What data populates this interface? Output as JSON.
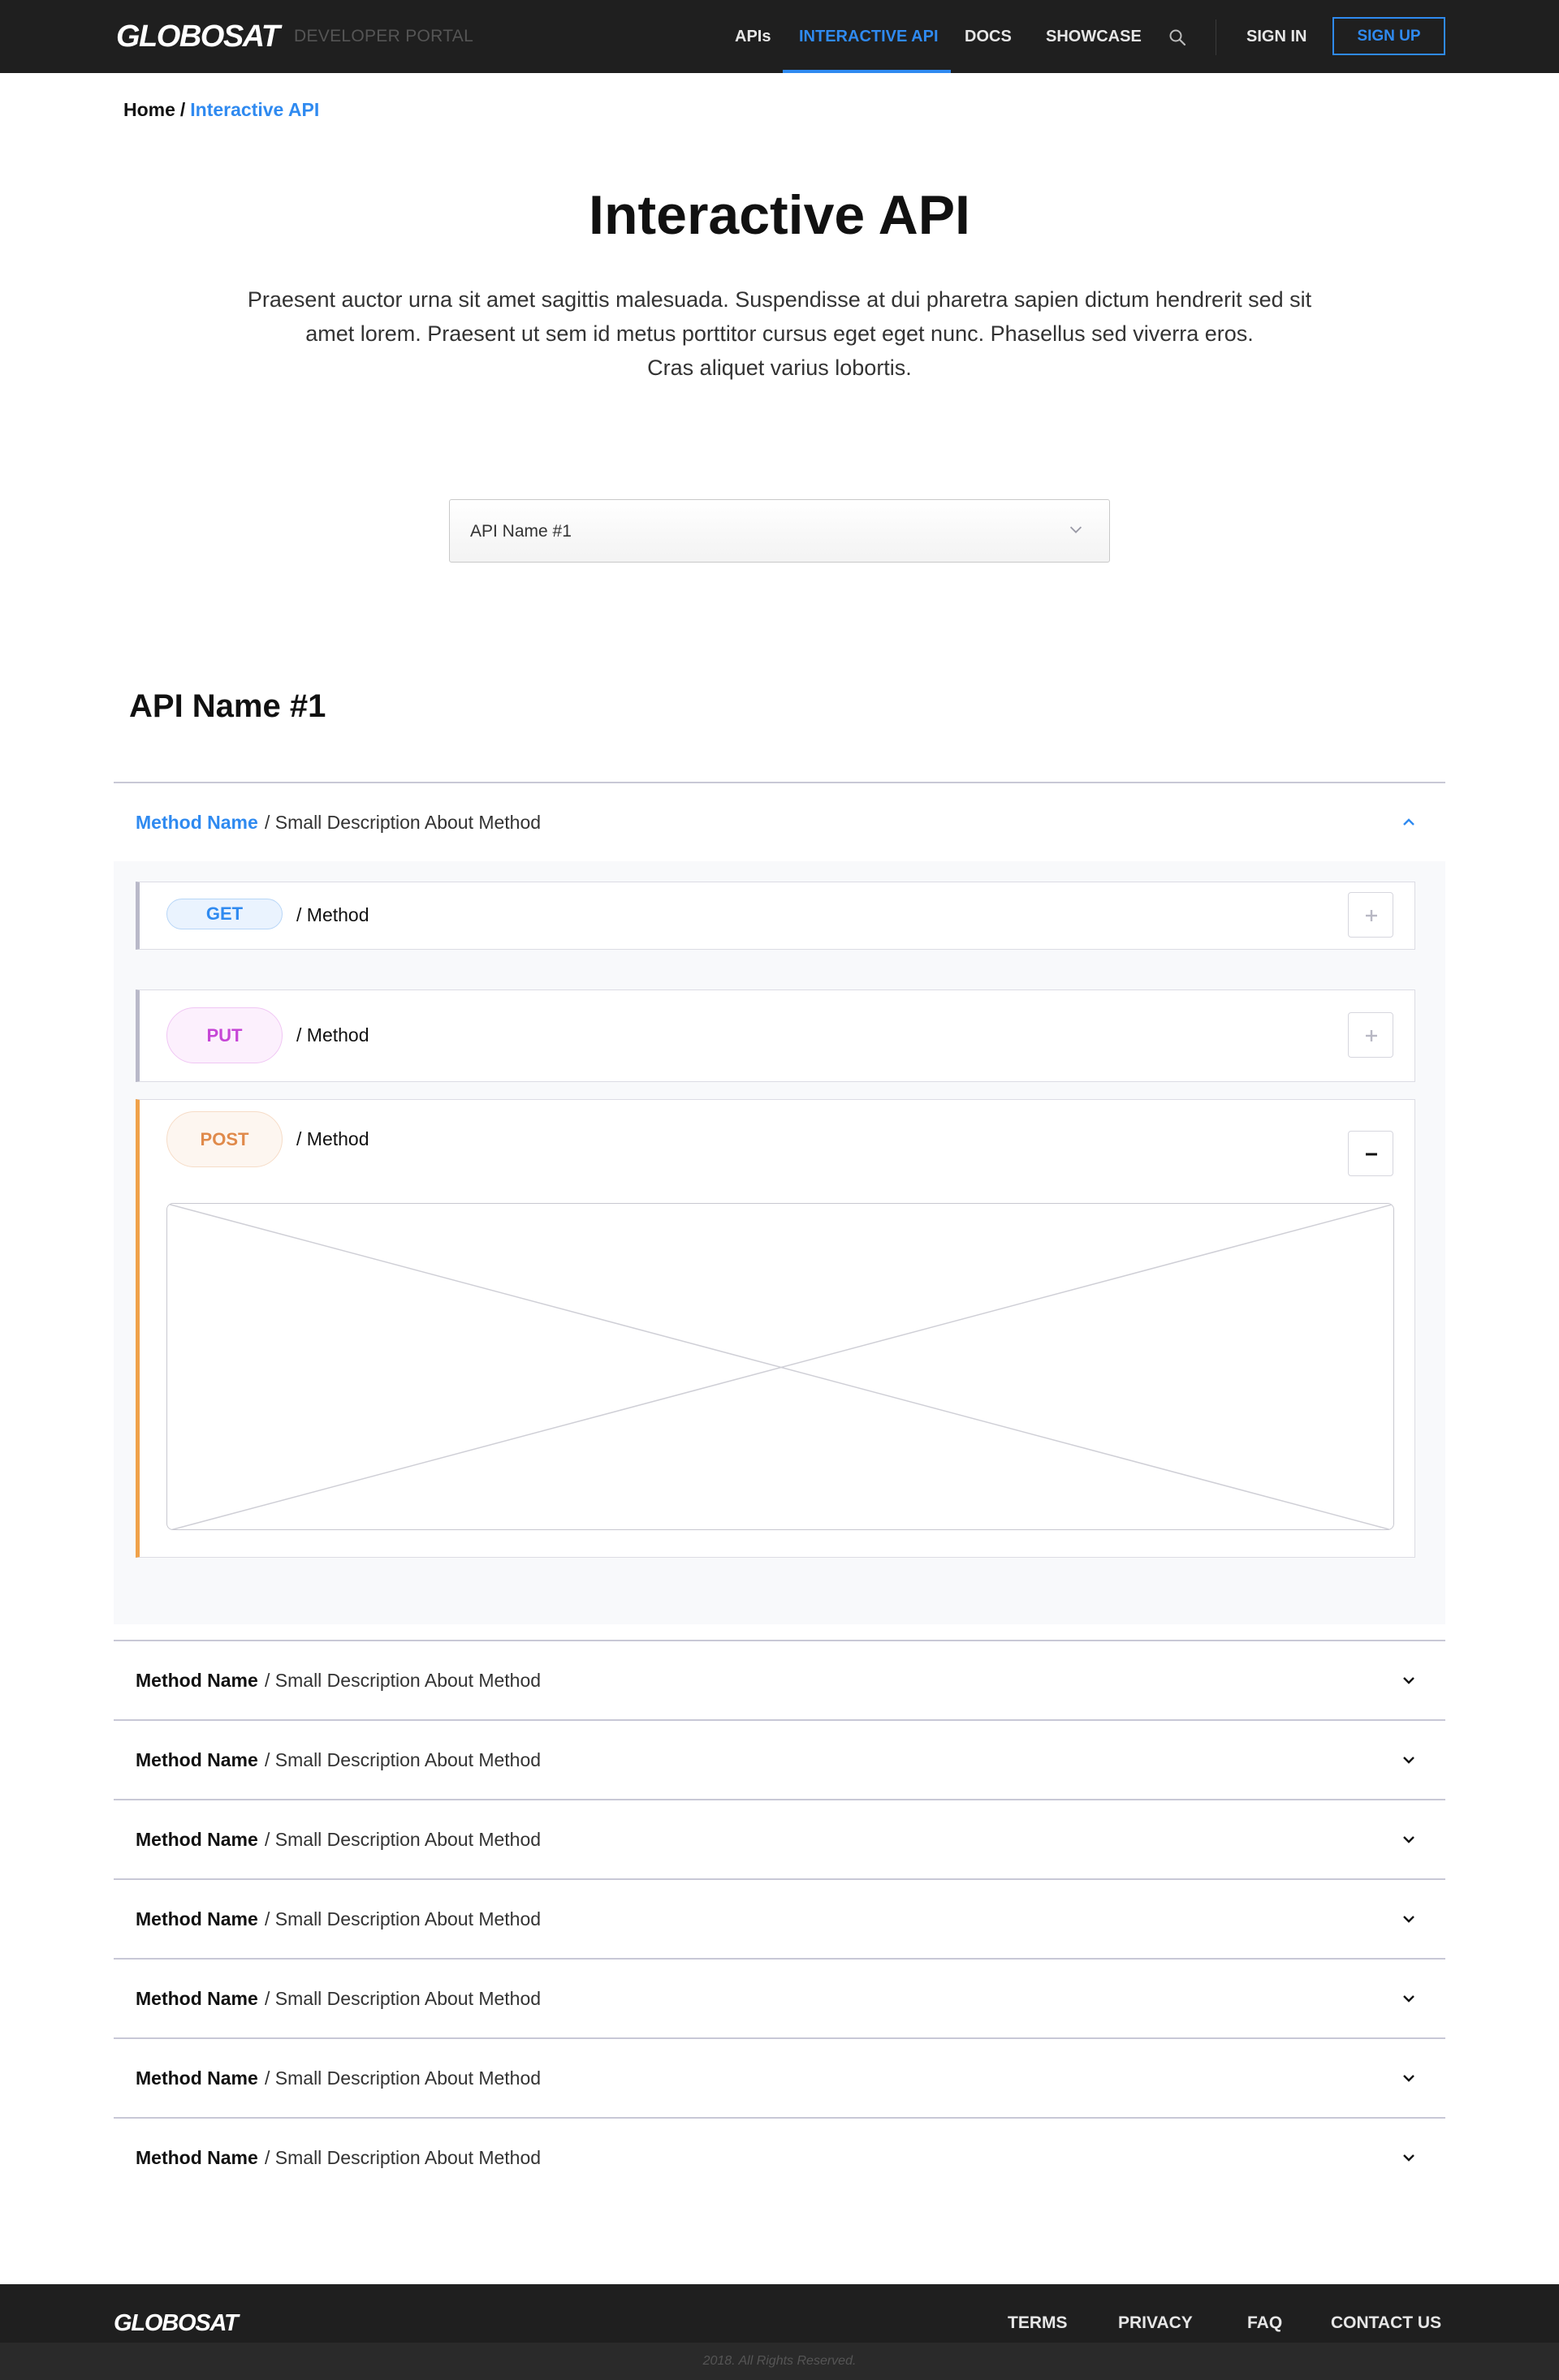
{
  "header": {
    "logo": "GLOBOSAT",
    "logo_sub": "DEVELOPER PORTAL",
    "nav": {
      "apis": "APIs",
      "interactive_api": "INTERACTIVE API",
      "docs": "DOCS",
      "showcase": "SHOWCASE"
    },
    "sign_in": "SIGN IN",
    "sign_up": "SIGN UP",
    "active_color": "#2f8af0"
  },
  "breadcrumb": {
    "home": "Home",
    "separator": "/",
    "current": "Interactive API"
  },
  "hero": {
    "title": "Interactive API",
    "intro_lines": [
      "Praesent auctor urna sit amet sagittis malesuada. Suspendisse at dui pharetra sapien dictum hendrerit sed sit",
      "amet lorem. Praesent ut sem id metus porttitor cursus eget eget nunc. Phasellus sed viverra eros.",
      "Cras aliquet varius lobortis."
    ]
  },
  "api_select": {
    "selected": "API Name #1"
  },
  "section": {
    "title": "API Name #1"
  },
  "methods": [
    {
      "name": "Method Name",
      "description": "/ Small Description About Method",
      "expanded": true
    },
    {
      "name": "Method Name",
      "description": "/ Small Description About Method",
      "expanded": false
    },
    {
      "name": "Method Name",
      "description": "/ Small Description About Method",
      "expanded": false
    },
    {
      "name": "Method Name",
      "description": "/ Small Description About Method",
      "expanded": false
    },
    {
      "name": "Method Name",
      "description": "/ Small Description About Method",
      "expanded": false
    },
    {
      "name": "Method Name",
      "description": "/ Small Description About Method",
      "expanded": false
    },
    {
      "name": "Method Name",
      "description": "/ Small Description About Method",
      "expanded": false
    },
    {
      "name": "Method Name",
      "description": "/ Small Description About Method",
      "expanded": false
    }
  ],
  "endpoints": [
    {
      "verb": "GET",
      "path": "/ Method",
      "expanded": false,
      "color": "#2f8af0",
      "toggle_icon": "plus-icon"
    },
    {
      "verb": "PUT",
      "path": "/ Method",
      "expanded": false,
      "color": "#c646d6",
      "toggle_icon": "plus-icon"
    },
    {
      "verb": "POST",
      "path": "/ Method",
      "expanded": true,
      "color": "#e08a4b",
      "toggle_icon": "minus-icon"
    }
  ],
  "footer": {
    "logo": "GLOBOSAT",
    "links": {
      "terms": "TERMS",
      "privacy": "PRIVACY",
      "faq": "FAQ",
      "contact": "CONTACT US"
    },
    "copyright": "2018. All Rights Reserved."
  }
}
